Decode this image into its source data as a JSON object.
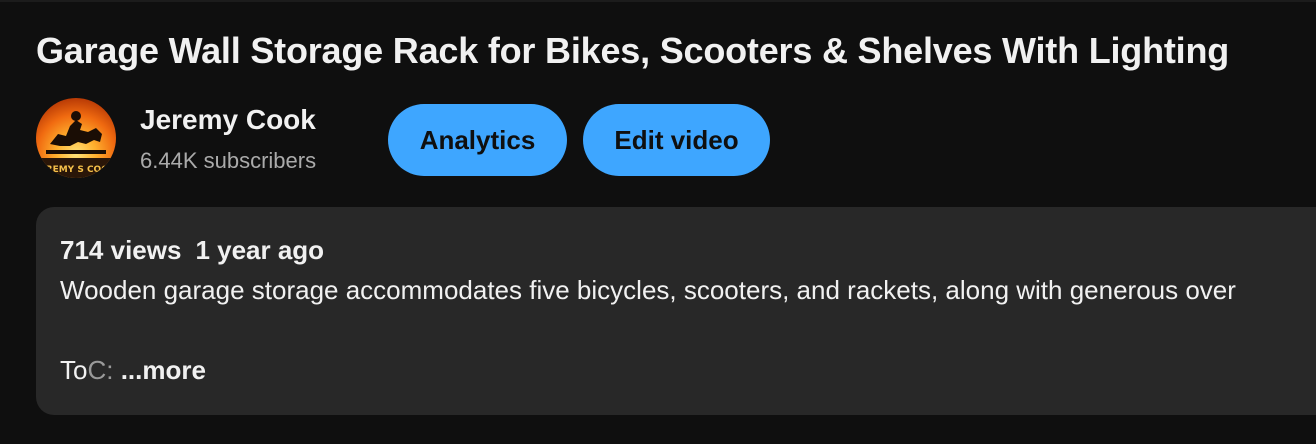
{
  "video": {
    "title": "Garage Wall Storage Rack for Bikes, Scooters & Shelves With Lighting"
  },
  "channel": {
    "name": "Jeremy Cook",
    "subscribers": "6.44K subscribers",
    "avatar_text": "JEREMY S COOK"
  },
  "actions": {
    "analytics_label": "Analytics",
    "edit_label": "Edit video"
  },
  "description": {
    "views": "714 views",
    "age": "1 year ago",
    "text": "Wooden garage storage accommodates five bicycles, scooters, and rackets, along with generous over",
    "toc_prefix": "To",
    "toc_faded": "C:",
    "more_label": " ...more"
  },
  "colors": {
    "background": "#0f0f0f",
    "button": "#3ea6ff",
    "description_bg": "#282828",
    "secondary_text": "#aaaaaa"
  }
}
